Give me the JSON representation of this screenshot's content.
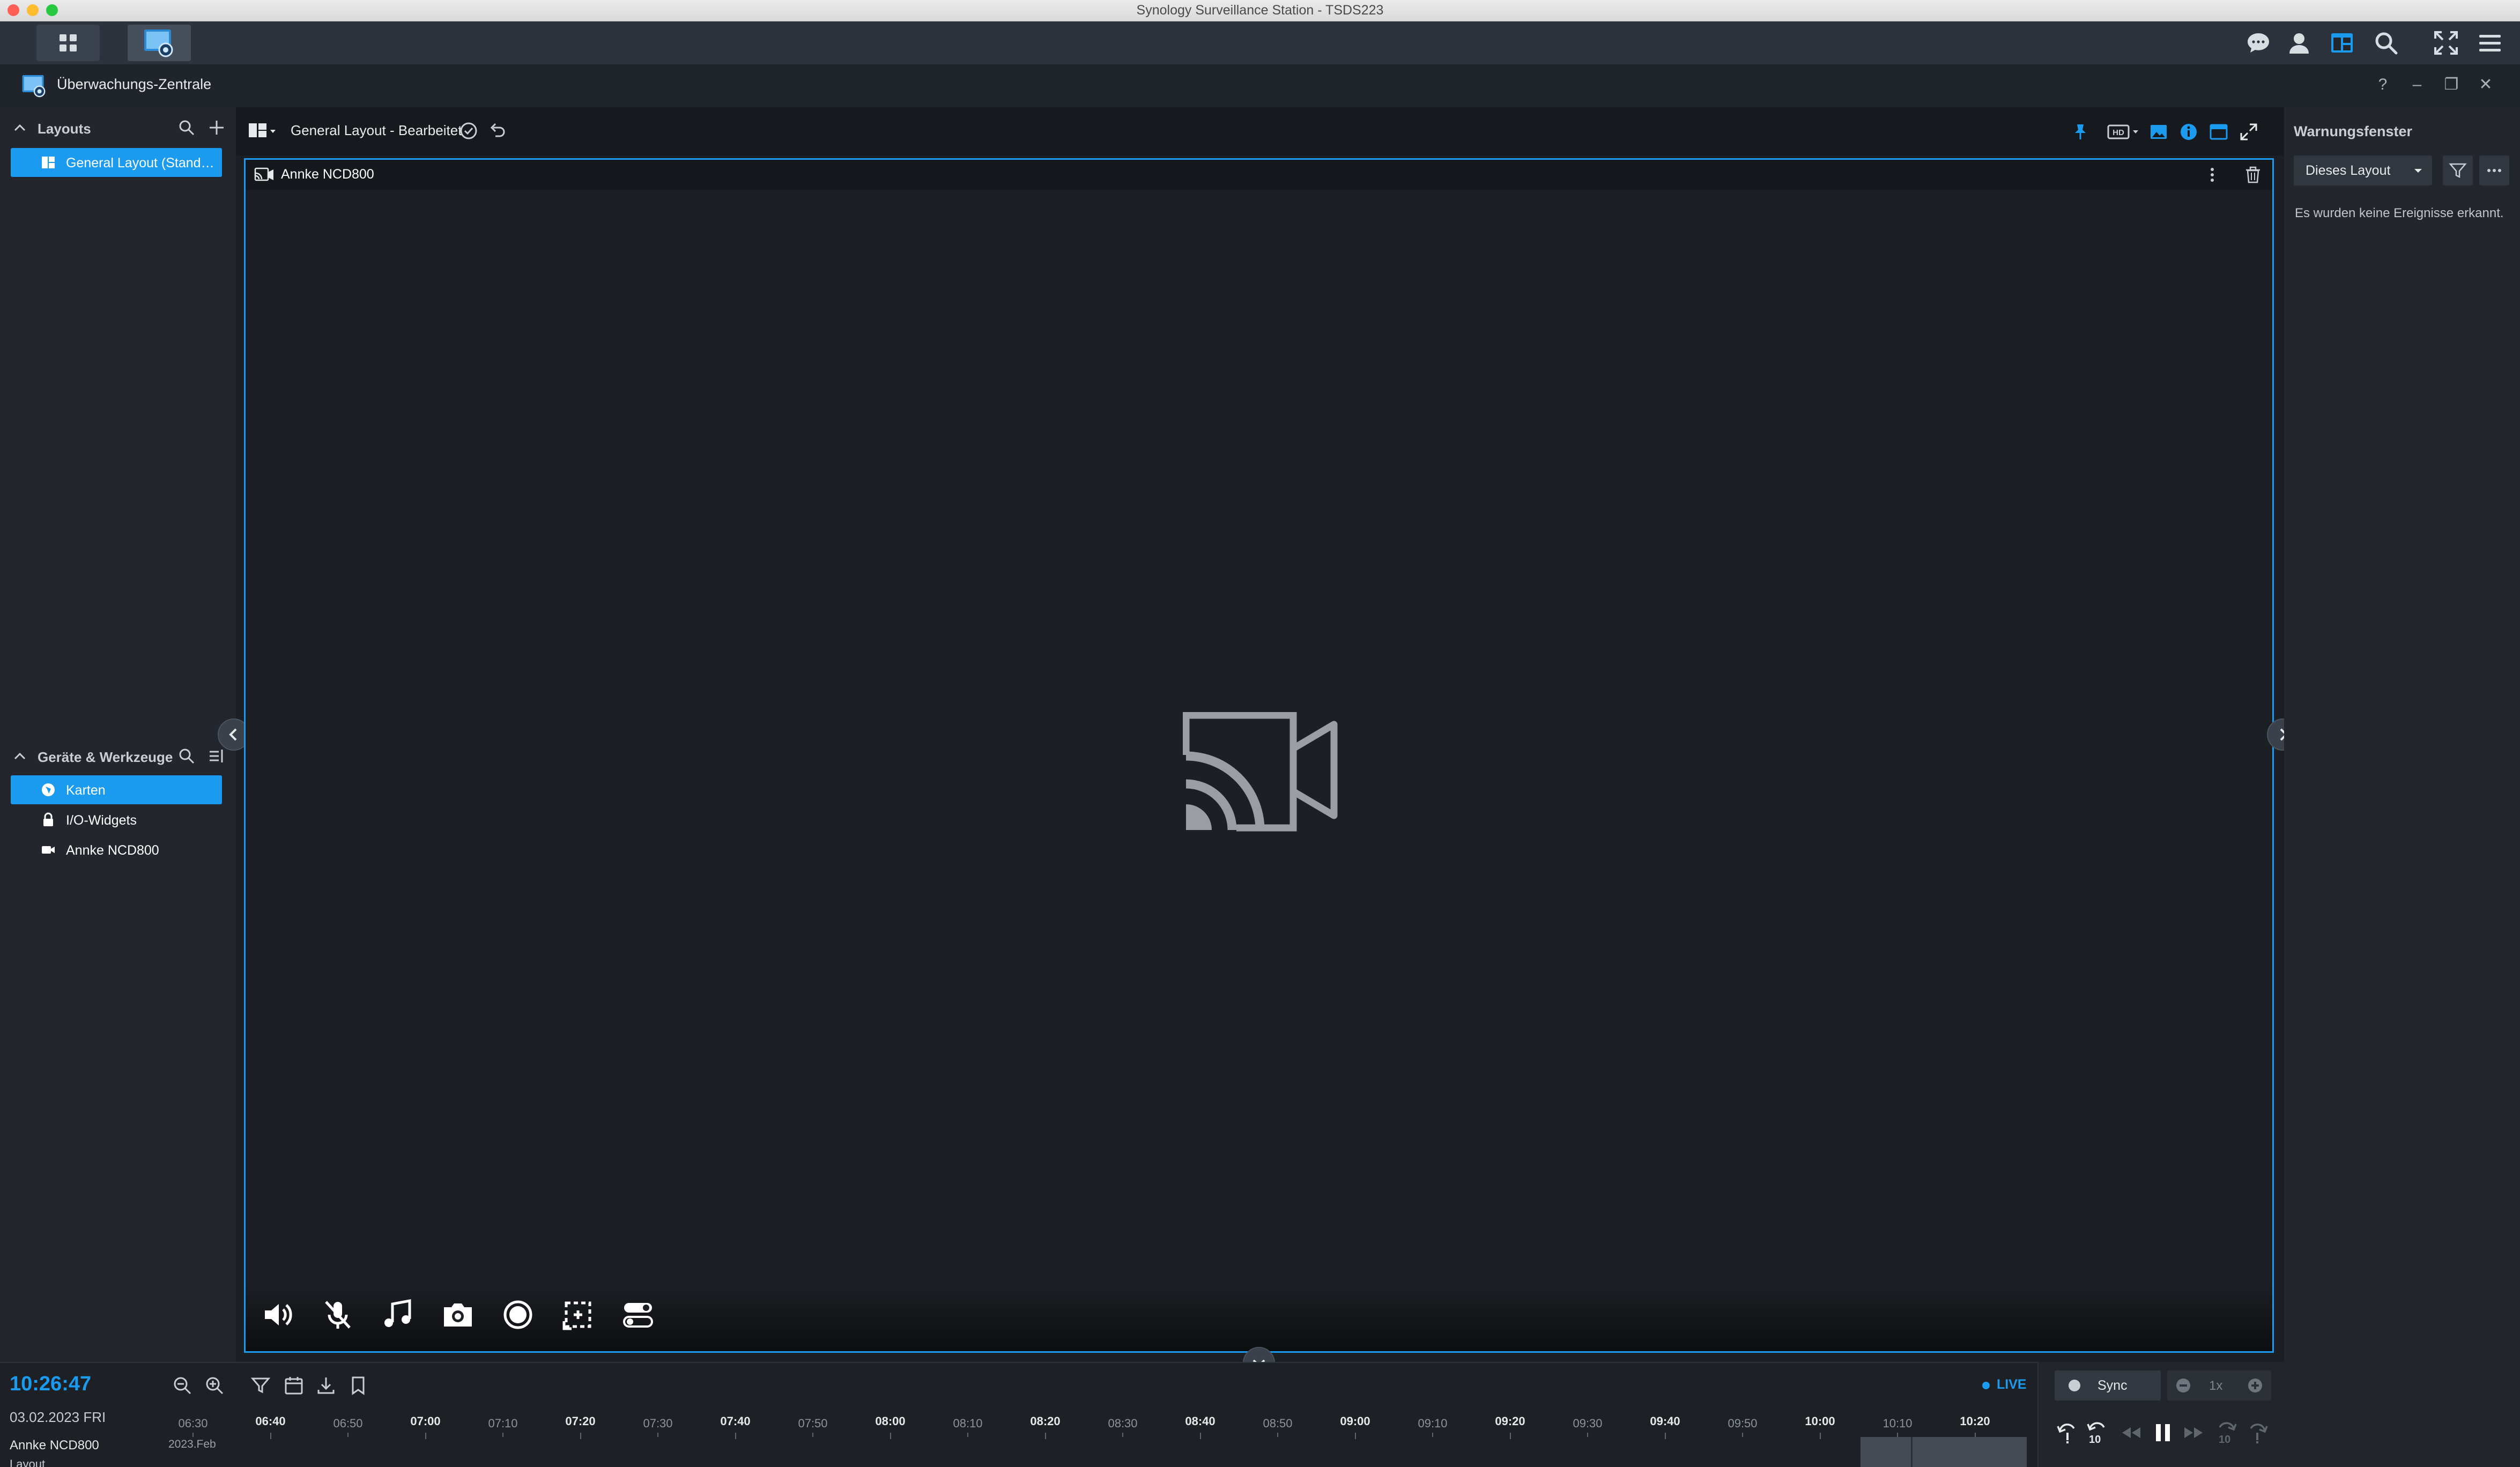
{
  "window": {
    "title": "Synology Surveillance Station - TSDS223"
  },
  "app": {
    "title": "Überwachungs-Zentrale",
    "controls": [
      "?",
      "–",
      "❐",
      "✕"
    ]
  },
  "sidebar": {
    "layouts_section": {
      "title": "Layouts",
      "items": [
        {
          "label": "General Layout (Standard)",
          "selected": true
        }
      ]
    },
    "devices_section": {
      "title": "Geräte & Werkzeuge",
      "items": [
        {
          "label": "Karten",
          "icon": "map-icon",
          "selected": true
        },
        {
          "label": "I/O-Widgets",
          "icon": "io-widget-icon",
          "selected": false
        },
        {
          "label": "Annke NCD800",
          "icon": "camera-icon",
          "selected": false
        }
      ]
    }
  },
  "main": {
    "layout_name": "General Layout - Bearbeitet",
    "cell": {
      "camera_name": "Annke NCD800",
      "status_icon": "camera-disconnected-icon"
    }
  },
  "right_panel": {
    "title": "Warnungsfenster",
    "scope": "Dieses Layout",
    "empty_text": "Es wurden keine Ereignisse erkannt."
  },
  "timeline": {
    "clock": "10:26:47",
    "date": "03.02.2023 FRI",
    "camera_row": "Annke NCD800",
    "layout_row": "Layout",
    "month_label": "2023.Feb",
    "live_label": "LIVE",
    "ticks": [
      {
        "label": "06:30",
        "major": false
      },
      {
        "label": "06:40",
        "major": true
      },
      {
        "label": "06:50",
        "major": false
      },
      {
        "label": "07:00",
        "major": true
      },
      {
        "label": "07:10",
        "major": false
      },
      {
        "label": "07:20",
        "major": true
      },
      {
        "label": "07:30",
        "major": false
      },
      {
        "label": "07:40",
        "major": true
      },
      {
        "label": "07:50",
        "major": false
      },
      {
        "label": "08:00",
        "major": true
      },
      {
        "label": "08:10",
        "major": false
      },
      {
        "label": "08:20",
        "major": true
      },
      {
        "label": "08:30",
        "major": false
      },
      {
        "label": "08:40",
        "major": true
      },
      {
        "label": "08:50",
        "major": false
      },
      {
        "label": "09:00",
        "major": true
      },
      {
        "label": "09:10",
        "major": false
      },
      {
        "label": "09:20",
        "major": true
      },
      {
        "label": "09:30",
        "major": false
      },
      {
        "label": "09:40",
        "major": true
      },
      {
        "label": "09:50",
        "major": false
      },
      {
        "label": "10:00",
        "major": true
      },
      {
        "label": "10:10",
        "major": false
      },
      {
        "label": "10:20",
        "major": true
      }
    ]
  },
  "playback": {
    "sync_label": "Sync",
    "speed": "1x",
    "skip_back_seconds": "10",
    "skip_forward_seconds": "10"
  },
  "colors": {
    "accent": "#1a9bf0",
    "background": "#1c1f24",
    "panel": "#23272d"
  }
}
